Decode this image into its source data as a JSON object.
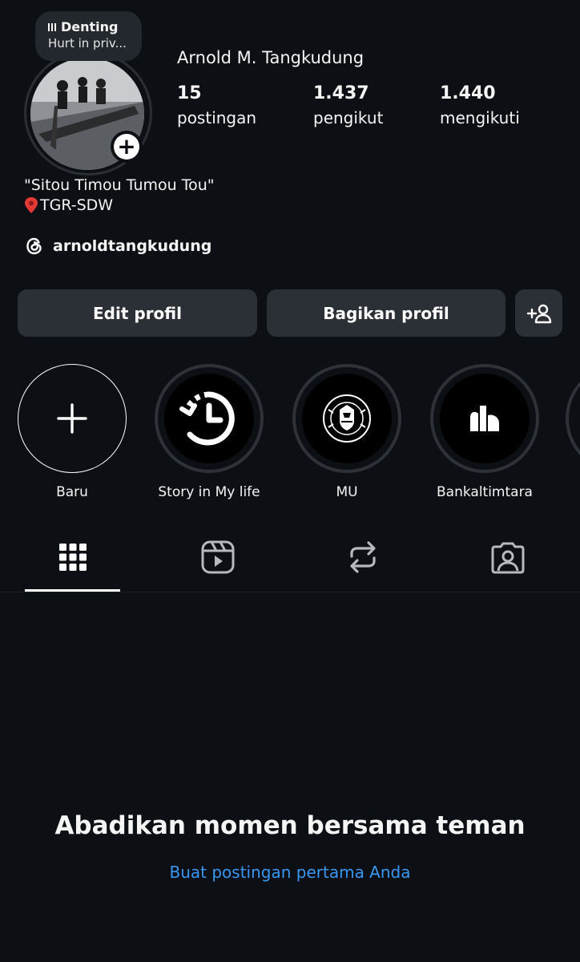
{
  "note": {
    "title": "Denting",
    "text": "Hurt in priv..."
  },
  "profile": {
    "name": "Arnold M. Tangkudung",
    "stats": [
      {
        "value": "15",
        "label": "postingan"
      },
      {
        "value": "1.437",
        "label": "pengikut"
      },
      {
        "value": "1.440",
        "label": "mengikuti"
      }
    ],
    "bio_line1": "\"Sitou Timou Tumou Tou\"",
    "bio_line2": "TGR-SDW",
    "threads_handle": "arnoldtangkudung"
  },
  "buttons": {
    "edit": "Edit profil",
    "share": "Bagikan profil"
  },
  "highlights": [
    {
      "label": "Baru"
    },
    {
      "label": "Story in My life"
    },
    {
      "label": "MU"
    },
    {
      "label": "Bankaltimtara"
    }
  ],
  "empty": {
    "title": "Abadikan momen bersama teman",
    "link": "Buat postingan pertama Anda"
  },
  "colors": {
    "background": "#0c0f14",
    "button": "#2b2f36",
    "link": "#3897f0"
  }
}
